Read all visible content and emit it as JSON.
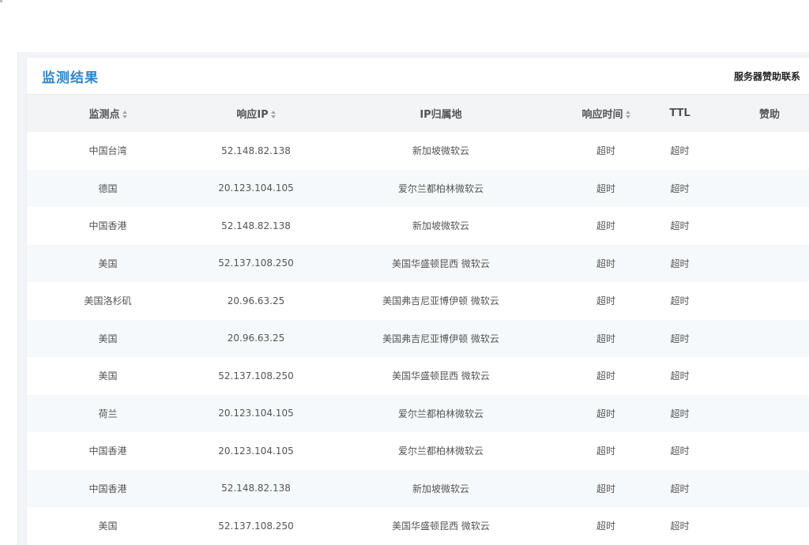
{
  "panel": {
    "title": "监测结果",
    "sponsor_link": "服务器赞助联系"
  },
  "table": {
    "headers": {
      "location": "监测点",
      "ip": "响应IP",
      "ip_location": "IP归属地",
      "response_time": "响应时间",
      "ttl": "TTL",
      "sponsor": "赞助"
    },
    "rows": [
      {
        "location": "中国台湾",
        "ip": "52.148.82.138",
        "ip_location": "新加坡微软云",
        "response_time": "超时",
        "ttl": "超时"
      },
      {
        "location": "德国",
        "ip": "20.123.104.105",
        "ip_location": "爱尔兰都柏林微软云",
        "response_time": "超时",
        "ttl": "超时"
      },
      {
        "location": "中国香港",
        "ip": "52.148.82.138",
        "ip_location": "新加坡微软云",
        "response_time": "超时",
        "ttl": "超时"
      },
      {
        "location": "美国",
        "ip": "52.137.108.250",
        "ip_location": "美国华盛顿昆西 微软云",
        "response_time": "超时",
        "ttl": "超时"
      },
      {
        "location": "美国洛杉矶",
        "ip": "20.96.63.25",
        "ip_location": "美国弗吉尼亚博伊顿 微软云",
        "response_time": "超时",
        "ttl": "超时"
      },
      {
        "location": "美国",
        "ip": "20.96.63.25",
        "ip_location": "美国弗吉尼亚博伊顿 微软云",
        "response_time": "超时",
        "ttl": "超时"
      },
      {
        "location": "美国",
        "ip": "52.137.108.250",
        "ip_location": "美国华盛顿昆西 微软云",
        "response_time": "超时",
        "ttl": "超时"
      },
      {
        "location": "荷兰",
        "ip": "20.123.104.105",
        "ip_location": "爱尔兰都柏林微软云",
        "response_time": "超时",
        "ttl": "超时"
      },
      {
        "location": "中国香港",
        "ip": "20.123.104.105",
        "ip_location": "爱尔兰都柏林微软云",
        "response_time": "超时",
        "ttl": "超时"
      },
      {
        "location": "中国香港",
        "ip": "52.148.82.138",
        "ip_location": "新加坡微软云",
        "response_time": "超时",
        "ttl": "超时"
      },
      {
        "location": "美国",
        "ip": "52.137.108.250",
        "ip_location": "美国华盛顿昆西 微软云",
        "response_time": "超时",
        "ttl": "超时"
      }
    ]
  },
  "colors": {
    "title": "#2f86c8",
    "ip_link": "#3586c2",
    "timeout": "#d62626",
    "header_bg": "#f3f4f5",
    "stripe_bg": "#f6f9fb"
  }
}
